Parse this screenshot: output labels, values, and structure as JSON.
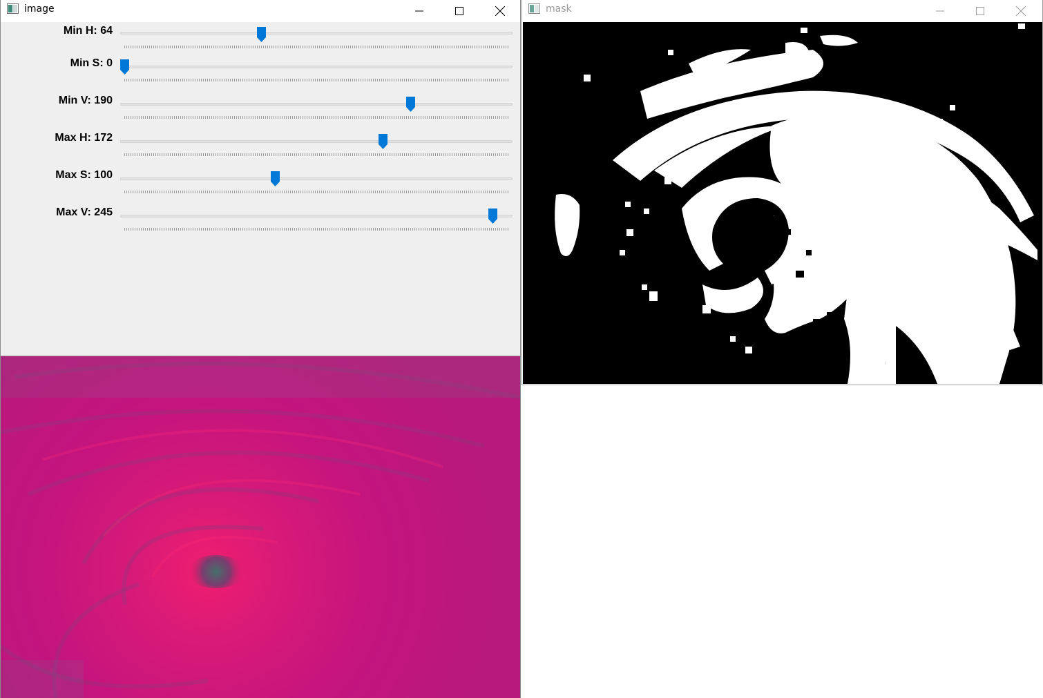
{
  "windows": {
    "image": {
      "title": "image",
      "trackbars": [
        {
          "label": "Min H: 64",
          "value": 64,
          "max": 179
        },
        {
          "label": "Min S: 0",
          "value": 0,
          "max": 255
        },
        {
          "label": "Min V: 190",
          "value": 190,
          "max": 255
        },
        {
          "label": "Max H: 172",
          "value": 172,
          "max": 255
        },
        {
          "label": "Max S: 100",
          "value": 100,
          "max": 255
        },
        {
          "label": "Max V: 245",
          "value": 245,
          "max": 255
        }
      ],
      "preview_colors": {
        "base": "#c8147c",
        "highlight": "#e8206e",
        "eye": "#4a6a6a"
      }
    },
    "mask": {
      "title": "mask",
      "colors": {
        "background": "#000000",
        "foreground": "#ffffff"
      }
    }
  },
  "colors": {
    "accent": "#0078d7",
    "panel": "#efefef"
  },
  "icons": [
    "app-icon",
    "minimize-icon",
    "maximize-icon",
    "close-icon"
  ]
}
